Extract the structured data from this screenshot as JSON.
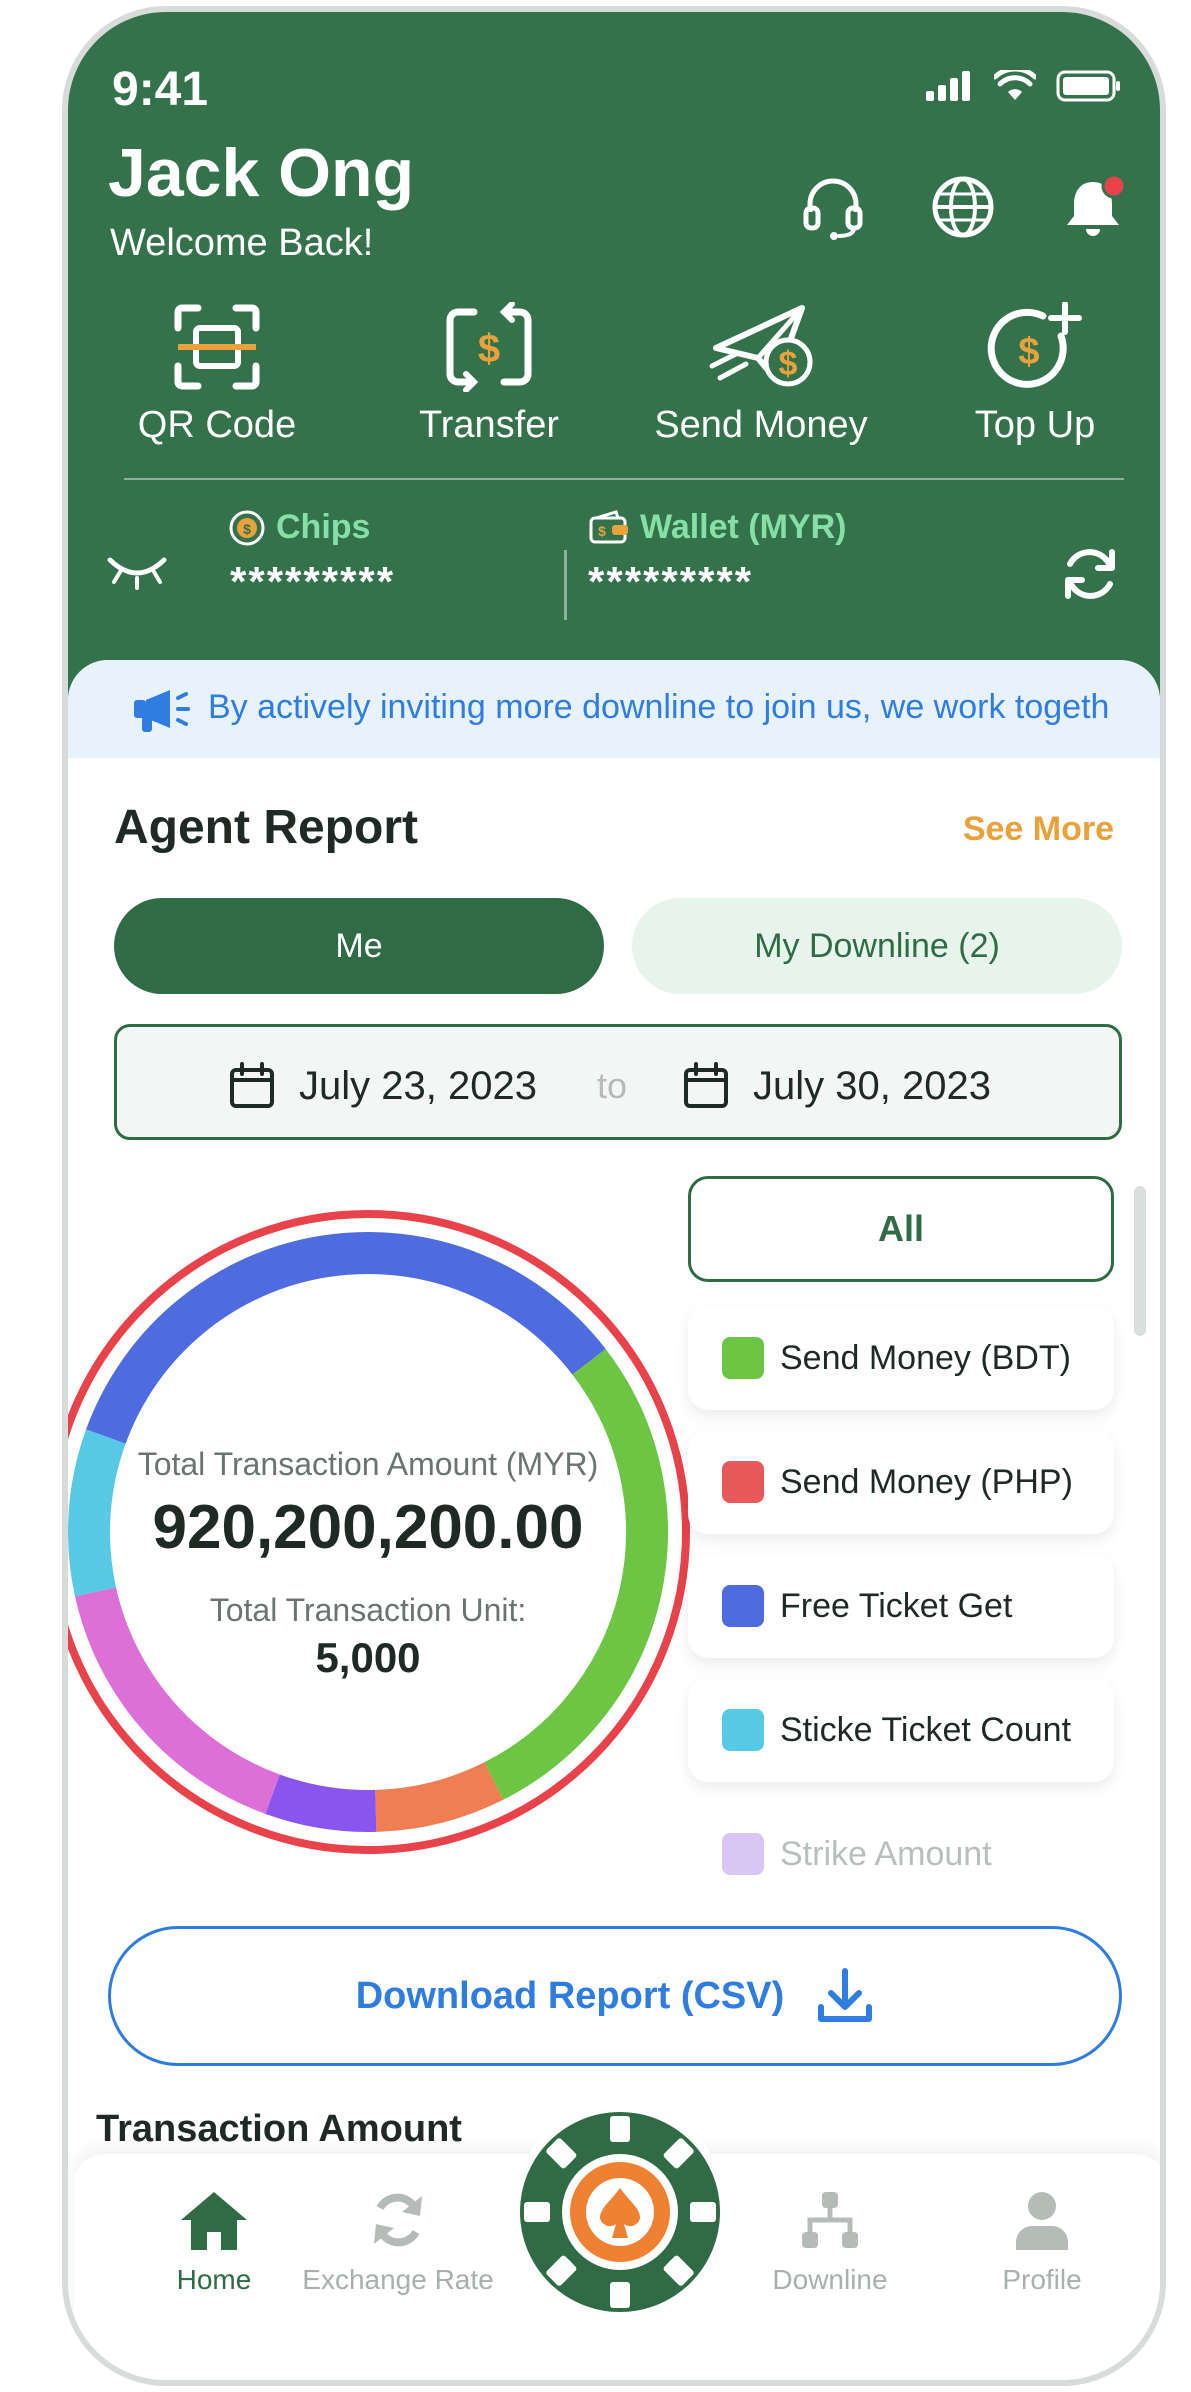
{
  "status_bar": {
    "time": "9:41"
  },
  "user": {
    "name": "Jack Ong",
    "greeting": "Welcome Back!"
  },
  "header_icons": [
    "headset-icon",
    "globe-icon",
    "bell-icon"
  ],
  "quick_actions": [
    {
      "label": "QR Code",
      "icon": "qr-scan-icon"
    },
    {
      "label": "Transfer",
      "icon": "transfer-icon"
    },
    {
      "label": "Send Money",
      "icon": "send-money-icon"
    },
    {
      "label": "Top Up",
      "icon": "top-up-icon"
    }
  ],
  "balances": {
    "chips_label": "Chips",
    "chips_value": "*********",
    "wallet_label": "Wallet (MYR)",
    "wallet_value": "*********"
  },
  "banner": {
    "text": "By actively inviting more downline to join us, we work togeth"
  },
  "agent_report": {
    "title": "Agent Report",
    "see_more": "See More",
    "tabs": [
      {
        "label": "Me",
        "active": true
      },
      {
        "label": "My Downline (2)",
        "active": false
      }
    ],
    "date_from": "July 23, 2023",
    "date_to_label": "to",
    "date_to": "July 30, 2023"
  },
  "summary": {
    "amount_label": "Total Transaction Amount (MYR)",
    "amount": "920,200,200.00",
    "unit_label": "Total Transaction Unit:",
    "unit": "5,000"
  },
  "filter": {
    "all_label": "All",
    "items": [
      {
        "label": "Send Money (BDT)",
        "color": "#6cc644"
      },
      {
        "label": "Send Money (PHP)",
        "color": "#e85a5a"
      },
      {
        "label": "Free Ticket Get",
        "color": "#4f6be0"
      },
      {
        "label": "Sticke Ticket Count",
        "color": "#57c9e6"
      },
      {
        "label": "Strike Amount",
        "color": "#d9c6f5"
      }
    ]
  },
  "chart_data": {
    "type": "pie",
    "donut": true,
    "segments": [
      {
        "color": "#4f6be0",
        "value": 34
      },
      {
        "color": "#6cc644",
        "value": 28
      },
      {
        "color": "#ef7e52",
        "value": 7
      },
      {
        "color": "#8a55ee",
        "value": 6
      },
      {
        "color": "#dd6fd8",
        "value": 16
      },
      {
        "color": "#57c9e6",
        "value": 9
      }
    ],
    "ring_color": "#e8424a"
  },
  "download": {
    "label": "Download Report (CSV)"
  },
  "transaction_section": {
    "title": "Transaction Amount"
  },
  "bottom_nav": [
    {
      "label": "Home",
      "active": true
    },
    {
      "label": "Exchange Rate",
      "active": false
    },
    {
      "label": "Downline",
      "active": false
    },
    {
      "label": "Profile",
      "active": false
    }
  ],
  "colors": {
    "primary": "#33724b",
    "accent_blue": "#2f7de0",
    "accent_orange": "#e9a23b"
  }
}
